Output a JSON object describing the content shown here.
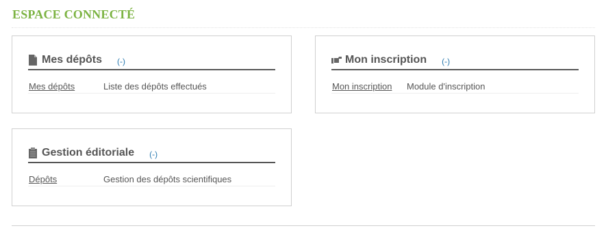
{
  "page": {
    "title": "ESPACE CONNECTÉ"
  },
  "cards": [
    {
      "title": "Mes dépôts",
      "icon": "document-icon",
      "toggle": "(-)",
      "link": "Mes dépôts",
      "description": "Liste des dépôts effectués"
    },
    {
      "title": "Mon inscription",
      "icon": "pointing-hand-icon",
      "toggle": "(-)",
      "link": "Mon inscription",
      "description": "Module d'inscription"
    },
    {
      "title": "Gestion éditoriale",
      "icon": "clipboard-icon",
      "toggle": "(-)",
      "link": "Dépôts",
      "description": "Gestion des dépôts scientifiques"
    }
  ],
  "colors": {
    "title": "#7cb342",
    "toggle": "#2a7ab0",
    "text": "#555555"
  }
}
